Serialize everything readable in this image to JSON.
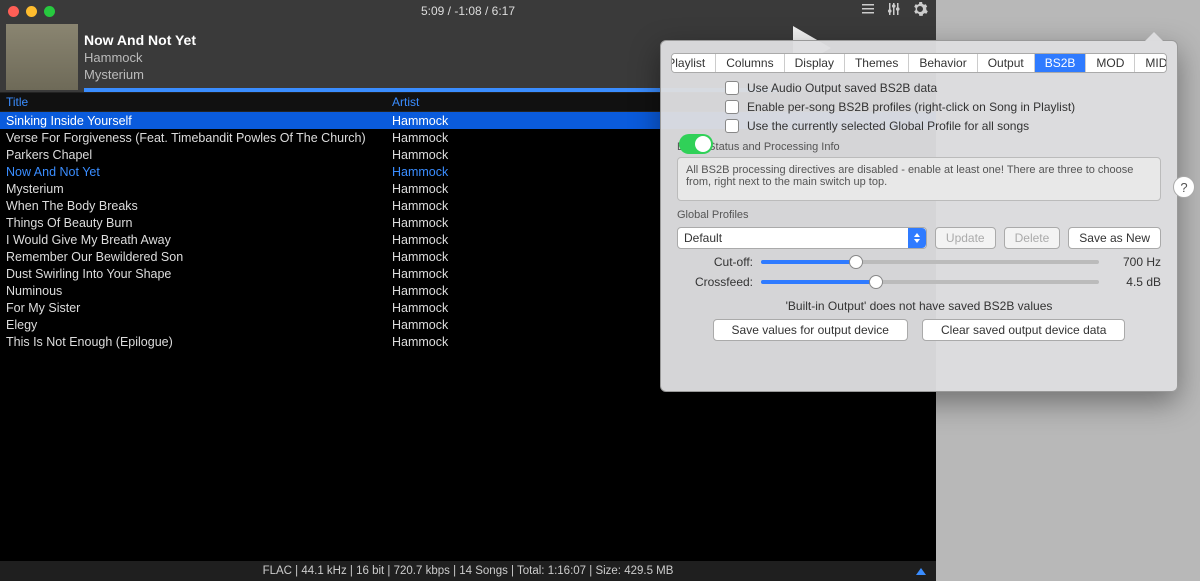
{
  "playback": {
    "elapsed": "5:09",
    "remaining": "-1:08",
    "total": "6:17",
    "display": "5:09 / -1:08 / 6:17"
  },
  "now_playing": {
    "title": "Now And Not Yet",
    "artist": "Hammock",
    "album": "Mysterium"
  },
  "columns": {
    "title": "Title",
    "artist": "Artist"
  },
  "tracks": [
    {
      "title": "Sinking Inside Yourself",
      "artist": "Hammock",
      "selected": true
    },
    {
      "title": "Verse For Forgiveness (Feat. Timebandit Powles Of The Church)",
      "artist": "Hammock"
    },
    {
      "title": "Parkers Chapel",
      "artist": "Hammock"
    },
    {
      "title": "Now And Not Yet",
      "artist": "Hammock",
      "playing": true
    },
    {
      "title": "Mysterium",
      "artist": "Hammock"
    },
    {
      "title": "When The Body Breaks",
      "artist": "Hammock"
    },
    {
      "title": "Things Of Beauty Burn",
      "artist": "Hammock"
    },
    {
      "title": "I Would Give My Breath Away",
      "artist": "Hammock"
    },
    {
      "title": "Remember Our Bewildered Son",
      "artist": "Hammock"
    },
    {
      "title": "Dust Swirling Into Your Shape",
      "artist": "Hammock"
    },
    {
      "title": "Numinous",
      "artist": "Hammock"
    },
    {
      "title": "For My Sister",
      "artist": "Hammock"
    },
    {
      "title": "Elegy",
      "artist": "Hammock"
    },
    {
      "title": "This Is Not Enough  (Epilogue)",
      "artist": "Hammock"
    }
  ],
  "status": "FLAC | 44.1 kHz | 16 bit | 720.7 kbps | 14 Songs | Total: 1:16:07 | Size: 429.5 MB",
  "prefs": {
    "tabs": [
      "Playlist",
      "Columns",
      "Display",
      "Themes",
      "Behavior",
      "Output",
      "BS2B",
      "MOD",
      "MIDI"
    ],
    "active_tab": "BS2B",
    "checks": {
      "use_saved": "Use Audio Output saved BS2B data",
      "per_song": "Enable per-song BS2B profiles (right-click on Song in Playlist)",
      "use_global": "Use the currently selected Global Profile for all songs"
    },
    "status_label": "BS2B Status and Processing Info",
    "status_text": "All BS2B processing directives are disabled - enable at least one! There are three to choose from, right next to the main switch up top.",
    "global_label": "Global Profiles",
    "profile_selected": "Default",
    "buttons": {
      "update": "Update",
      "delete": "Delete",
      "save_new": "Save as New"
    },
    "sliders": {
      "cutoff": {
        "label": "Cut-off:",
        "value": "700 Hz",
        "pos": 28
      },
      "crossfeed": {
        "label": "Crossfeed:",
        "value": "4.5 dB",
        "pos": 34
      }
    },
    "note": "'Built-in Output' does not have saved BS2B values",
    "bottom": {
      "save_device": "Save values for output device",
      "clear_device": "Clear saved output device data"
    },
    "help": "?"
  }
}
